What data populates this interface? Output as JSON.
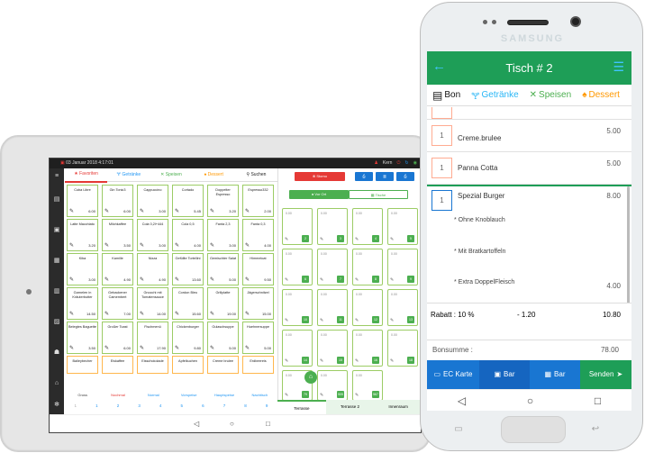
{
  "tablet": {
    "status": {
      "date": "03 Januar 2018 4:17:01",
      "user": "Kern"
    },
    "tabs": [
      "Favoriten",
      "Getränke",
      "Speisen",
      "Dessert",
      "Suchen"
    ],
    "products": [
      {
        "name": "Cuba Libre",
        "price": "6.00"
      },
      {
        "name": "Gin Tonic3",
        "price": "6.00"
      },
      {
        "name": "Cappuccino",
        "price": "3.00"
      },
      {
        "name": "Cortado",
        "price": "5.45"
      },
      {
        "name": "Doppelter Espresso",
        "price": "3.20"
      },
      {
        "name": "Espresso332",
        "price": "2.00"
      },
      {
        "name": "Latte Macchiato",
        "price": "3.20"
      },
      {
        "name": "Milchkaffee",
        "price": "3.50"
      },
      {
        "name": "Cola 0,2l+444",
        "price": "3.00"
      },
      {
        "name": "Cola 0,5",
        "price": "4.00"
      },
      {
        "name": "Fanta 2,3",
        "price": "3.00"
      },
      {
        "name": "Fanta 0,3",
        "price": "4.00"
      },
      {
        "name": "Kiba",
        "price": "3.00"
      },
      {
        "name": "Kamille",
        "price": "4.90"
      },
      {
        "name": "Nizza",
        "price": "4.90"
      },
      {
        "name": "Gefüllte Tortellini",
        "price": "13.60"
      },
      {
        "name": "Gemischter Salat",
        "price": "5.00"
      },
      {
        "name": "Himmeloat",
        "price": "9.50"
      },
      {
        "name": "Garnelen in Kräuterbutter",
        "price": "14.50"
      },
      {
        "name": "Gebackener Camembert",
        "price": "7.00"
      },
      {
        "name": "Gnocchi mit Tomatensauce",
        "price": "14.00"
      },
      {
        "name": "Cordon Bleu",
        "price": "15.60"
      },
      {
        "name": "Grillplatte",
        "price": "19.00"
      },
      {
        "name": "Jägerschnitzel",
        "price": "15.00"
      },
      {
        "name": "Belegtes Baguette",
        "price": "3.50"
      },
      {
        "name": "Großer Toast",
        "price": "6.00"
      },
      {
        "name": "Fischmenü",
        "price": "17.90"
      },
      {
        "name": "Chickenburger",
        "price": "9.80"
      },
      {
        "name": "Gulaschsuppe",
        "price": "5.00"
      },
      {
        "name": "Huehnersuppe",
        "price": "5.00"
      },
      {
        "name": "Baileybecher",
        "price": ""
      },
      {
        "name": "Eiskaffee",
        "price": ""
      },
      {
        "name": "Eisschokolade",
        "price": ""
      },
      {
        "name": "Apfelkuchen",
        "price": ""
      },
      {
        "name": "Creme brulee",
        "price": ""
      },
      {
        "name": "Erdbeereis",
        "price": ""
      }
    ],
    "categories": [
      "Gruss",
      "Nochmal",
      "Normal",
      "Vorspeise",
      "Hauptspeise",
      "Nachtisch"
    ],
    "pages": [
      "1",
      "1",
      "2",
      "3",
      "4",
      "5",
      "6",
      "7",
      "8",
      "9"
    ],
    "storno_label": "Storno",
    "view_tabs": [
      "Vor Ort",
      "Tische"
    ],
    "tables": [
      {
        "value": "0.00",
        "num": "2"
      },
      {
        "value": "0.00",
        "num": "3"
      },
      {
        "value": "0.00",
        "num": "4"
      },
      {
        "value": "0.00",
        "num": "5"
      },
      {
        "value": "0.00",
        "num": "6"
      },
      {
        "value": "0.00",
        "num": "7"
      },
      {
        "value": "0.00",
        "num": "8"
      },
      {
        "value": "0.00",
        "num": "9"
      },
      {
        "value": "0.00",
        "num": "10"
      },
      {
        "value": "0.00",
        "num": "11"
      },
      {
        "value": "0.00",
        "num": "12"
      },
      {
        "value": "0.00",
        "num": "13"
      },
      {
        "value": "0.00",
        "num": "14"
      },
      {
        "value": "0.00",
        "num": "15"
      },
      {
        "value": "0.00",
        "num": "16"
      },
      {
        "value": "0.00",
        "num": "18"
      },
      {
        "value": "0.00",
        "num": "79"
      },
      {
        "value": "0.00",
        "num": "505"
      },
      {
        "value": "0.00",
        "num": "567"
      }
    ],
    "rooms": [
      "Terrasse",
      "Terrasse 2",
      "Innenraum"
    ]
  },
  "phone": {
    "brand": "SAMSUNG",
    "title": "Tisch # 2",
    "menu": [
      "Bon",
      "Getränke",
      "Speisen",
      "Dessert"
    ],
    "items": [
      {
        "qty": "1",
        "name": "Creme.brulee",
        "price": "5.00"
      },
      {
        "qty": "1",
        "name": "Panna Cotta",
        "price": "5.00"
      },
      {
        "qty": "1",
        "name": "Spezial Burger",
        "price": "8.00"
      }
    ],
    "modifiers": [
      {
        "text": "* Ohne Knoblauch",
        "price": ""
      },
      {
        "text": "* Mit  Bratkartoffeln",
        "price": ""
      },
      {
        "text": "* Extra  DoppelFleisch",
        "price": "4.00"
      }
    ],
    "rabatt_label": "Rabatt : 10 %",
    "rabatt_value": "- 1.20",
    "rabatt_total": "10.80",
    "bonsumme_label": "Bonsumme :",
    "bonsumme_value": "78.00",
    "buttons": [
      "EC Karte",
      "Bar",
      "Bar",
      "Senden"
    ]
  }
}
